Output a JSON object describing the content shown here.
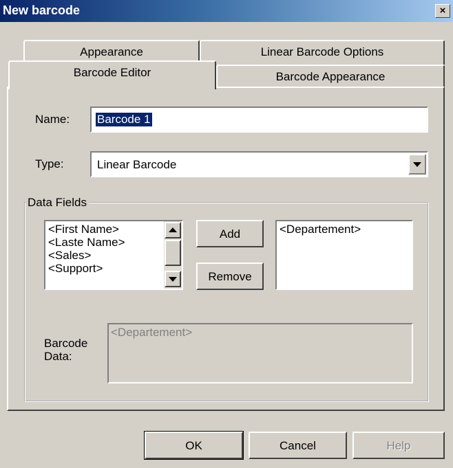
{
  "window": {
    "title": "New barcode",
    "close_symbol": "×"
  },
  "tabs": {
    "row_back": [
      "Appearance",
      "Linear Barcode Options"
    ],
    "row_front": [
      "Barcode Editor",
      "Barcode Appearance"
    ],
    "selected": "Barcode Editor"
  },
  "form": {
    "name_label": "Name:",
    "name_value": "Barcode 1",
    "type_label": "Type:",
    "type_value": "Linear Barcode"
  },
  "data_fields": {
    "legend": "Data Fields",
    "available": [
      "<First Name>",
      "<Laste Name>",
      "<Sales>",
      "<Support>"
    ],
    "selected": [
      "<Departement>"
    ],
    "add_label": "Add",
    "remove_label": "Remove"
  },
  "barcode_data": {
    "label_line1": "Barcode",
    "label_line2": "Data:",
    "value": "<Departement>"
  },
  "buttons": {
    "ok": "OK",
    "cancel": "Cancel",
    "help": "Help"
  },
  "colors": {
    "titlebar_start": "#0a246a",
    "titlebar_end": "#a6caf0",
    "selection": "#0a246a",
    "disabled_text": "#808080"
  }
}
